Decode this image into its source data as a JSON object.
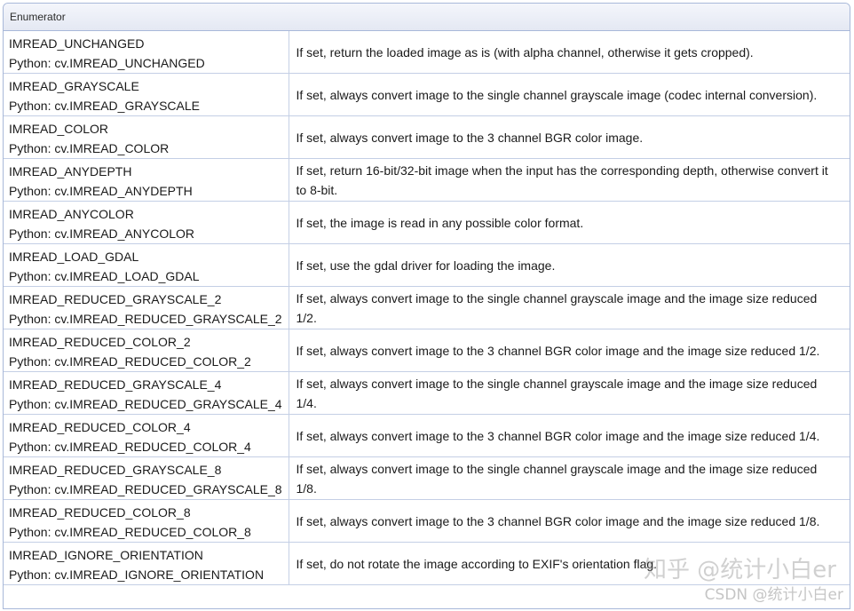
{
  "table": {
    "header": "Enumerator",
    "rows": [
      {
        "name": "IMREAD_UNCHANGED",
        "python": "Python: cv.IMREAD_UNCHANGED",
        "description": "If set, return the loaded image as is (with alpha channel, otherwise it gets cropped)."
      },
      {
        "name": "IMREAD_GRAYSCALE",
        "python": "Python: cv.IMREAD_GRAYSCALE",
        "description": "If set, always convert image to the single channel grayscale image (codec internal conversion)."
      },
      {
        "name": "IMREAD_COLOR",
        "python": "Python: cv.IMREAD_COLOR",
        "description": "If set, always convert image to the 3 channel BGR color image."
      },
      {
        "name": "IMREAD_ANYDEPTH",
        "python": "Python: cv.IMREAD_ANYDEPTH",
        "description": "If set, return 16-bit/32-bit image when the input has the corresponding depth, otherwise convert it to 8-bit."
      },
      {
        "name": "IMREAD_ANYCOLOR",
        "python": "Python: cv.IMREAD_ANYCOLOR",
        "description": "If set, the image is read in any possible color format."
      },
      {
        "name": "IMREAD_LOAD_GDAL",
        "python": "Python: cv.IMREAD_LOAD_GDAL",
        "description": "If set, use the gdal driver for loading the image."
      },
      {
        "name": "IMREAD_REDUCED_GRAYSCALE_2",
        "python": "Python: cv.IMREAD_REDUCED_GRAYSCALE_2",
        "description": "If set, always convert image to the single channel grayscale image and the image size reduced 1/2."
      },
      {
        "name": "IMREAD_REDUCED_COLOR_2",
        "python": "Python: cv.IMREAD_REDUCED_COLOR_2",
        "description": "If set, always convert image to the 3 channel BGR color image and the image size reduced 1/2."
      },
      {
        "name": "IMREAD_REDUCED_GRAYSCALE_4",
        "python": "Python: cv.IMREAD_REDUCED_GRAYSCALE_4",
        "description": "If set, always convert image to the single channel grayscale image and the image size reduced 1/4."
      },
      {
        "name": "IMREAD_REDUCED_COLOR_4",
        "python": "Python: cv.IMREAD_REDUCED_COLOR_4",
        "description": "If set, always convert image to the 3 channel BGR color image and the image size reduced 1/4."
      },
      {
        "name": "IMREAD_REDUCED_GRAYSCALE_8",
        "python": "Python: cv.IMREAD_REDUCED_GRAYSCALE_8",
        "description": "If set, always convert image to the single channel grayscale image and the image size reduced 1/8."
      },
      {
        "name": "IMREAD_REDUCED_COLOR_8",
        "python": "Python: cv.IMREAD_REDUCED_COLOR_8",
        "description": "If set, always convert image to the 3 channel BGR color image and the image size reduced 1/8."
      },
      {
        "name": "IMREAD_IGNORE_ORIENTATION",
        "python": "Python: cv.IMREAD_IGNORE_ORIENTATION",
        "description": "If set, do not rotate the image according to EXIF's orientation flag."
      }
    ]
  },
  "watermarks": {
    "zhihu": "知乎 @统计小白er",
    "csdn": "CSDN @统计小白er"
  },
  "colors": {
    "border": "#c4cfe5",
    "header_bg": "#e4e8f3",
    "outer_border": "#a8b8d9"
  }
}
